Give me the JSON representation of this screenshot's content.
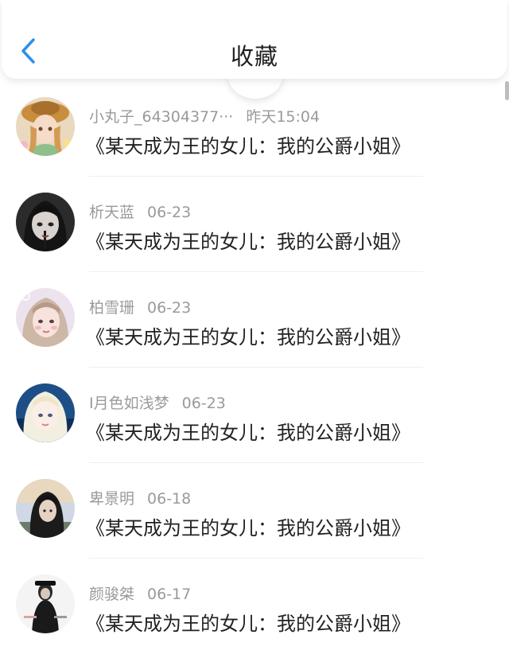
{
  "header": {
    "title": "收藏",
    "back_icon": "chevron-left-icon",
    "accent_color": "#2f8fe8"
  },
  "favorites": [
    {
      "user": "小丸子_64304377···",
      "time": "昨天15:04",
      "text": "《某天成为王的女儿：我的公爵小姐》"
    },
    {
      "user": "析天蓝",
      "time": "06-23",
      "text": "《某天成为王的女儿：我的公爵小姐》"
    },
    {
      "user": "柏雪珊",
      "time": "06-23",
      "text": "《某天成为王的女儿：我的公爵小姐》"
    },
    {
      "user": "I月色如浅梦",
      "time": "06-23",
      "text": "《某天成为王的女儿：我的公爵小姐》"
    },
    {
      "user": "卑景明",
      "time": "06-18",
      "text": "《某天成为王的女儿：我的公爵小姐》"
    },
    {
      "user": "颜骏桀",
      "time": "06-17",
      "text": "《某天成为王的女儿：我的公爵小姐》"
    }
  ]
}
